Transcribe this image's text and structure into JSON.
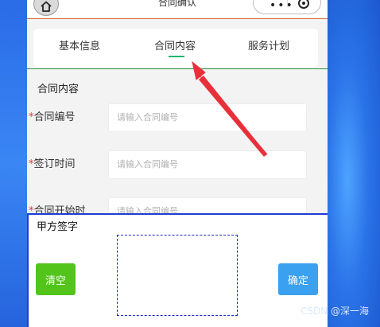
{
  "navbar": {
    "title": "合同确认"
  },
  "tabs": [
    {
      "label": "基本信息"
    },
    {
      "label": "合同内容"
    },
    {
      "label": "服务计划"
    }
  ],
  "active_tab": "合同内容",
  "form": {
    "section_title": "合同内容",
    "required_mark": "*",
    "rows": [
      {
        "label": "合同编号",
        "placeholder": "请输入合同编号"
      },
      {
        "label": "签订时间",
        "placeholder": "请输入合同编号"
      },
      {
        "label": "合同开始时",
        "placeholder": "请输入合同编号"
      }
    ]
  },
  "signature": {
    "title": "甲方签字",
    "clear_label": "清空",
    "confirm_label": "确定"
  },
  "watermark": "CSDN @深一海",
  "colors": {
    "accent_green": "#18b66f",
    "clear_button": "#52c41a",
    "confirm_button": "#3aa0f0",
    "annotation_arrow": "#e8303a",
    "signature_border": "#1c3ed6"
  }
}
